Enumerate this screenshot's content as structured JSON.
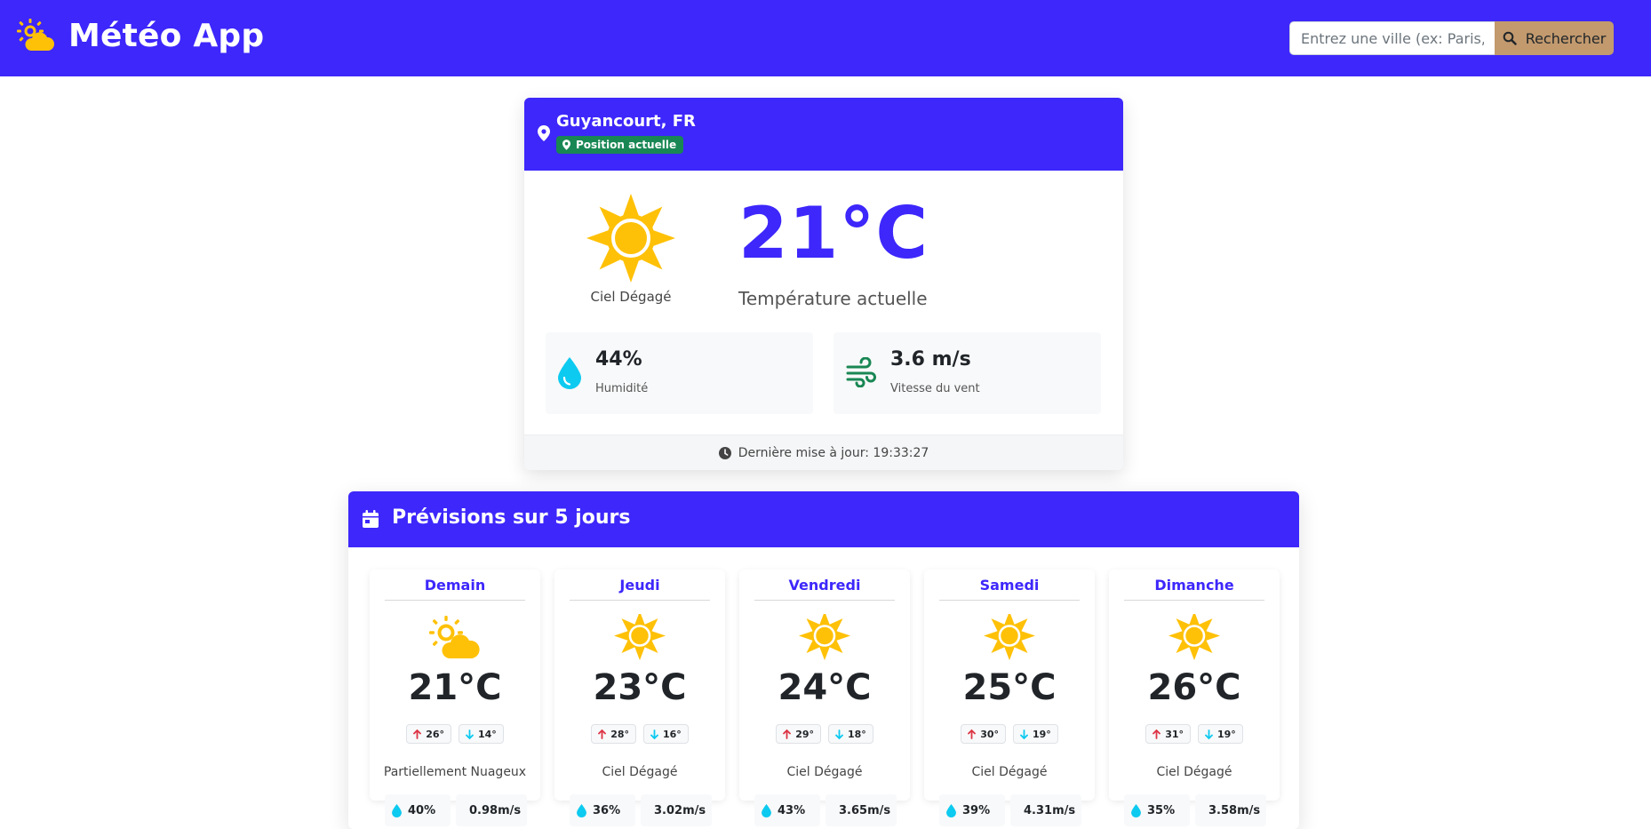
{
  "header": {
    "title": "Météo App",
    "search_placeholder": "Entrez une ville (ex: Paris, London...)",
    "search_value": "",
    "search_button": "Rechercher"
  },
  "current": {
    "city": "Guyancourt, FR",
    "badge": "Position actuelle",
    "condition": "Ciel Dégagé",
    "temperature": "21°C",
    "temperature_label": "Température actuelle",
    "humidity_value": "44%",
    "humidity_label": "Humidité",
    "wind_value": "3.6 m/s",
    "wind_label": "Vitesse du vent",
    "updated": "Dernière mise à jour: 19:33:27"
  },
  "forecast": {
    "title": "Prévisions sur 5 jours",
    "days": [
      {
        "name": "Demain",
        "icon": "partly-cloudy-icon",
        "temp": "21°C",
        "max": "26°",
        "min": "14°",
        "desc": "Partiellement Nuageux",
        "humidity": "40%",
        "wind": "0.98m/s"
      },
      {
        "name": "Jeudi",
        "icon": "sun-icon",
        "temp": "23°C",
        "max": "28°",
        "min": "16°",
        "desc": "Ciel Dégagé",
        "humidity": "36%",
        "wind": "3.02m/s"
      },
      {
        "name": "Vendredi",
        "icon": "sun-icon",
        "temp": "24°C",
        "max": "29°",
        "min": "18°",
        "desc": "Ciel Dégagé",
        "humidity": "43%",
        "wind": "3.65m/s"
      },
      {
        "name": "Samedi",
        "icon": "sun-icon",
        "temp": "25°C",
        "max": "30°",
        "min": "19°",
        "desc": "Ciel Dégagé",
        "humidity": "39%",
        "wind": "4.31m/s"
      },
      {
        "name": "Dimanche",
        "icon": "sun-icon",
        "temp": "26°C",
        "max": "31°",
        "min": "19°",
        "desc": "Ciel Dégagé",
        "humidity": "35%",
        "wind": "3.58m/s"
      }
    ]
  },
  "colors": {
    "primary": "#3d27fb",
    "sun": "#ffc107",
    "search_button": "#c29a6e",
    "badge": "#198754",
    "humidity_icon": "#0dcaf0",
    "wind_icon": "#198754",
    "arrow_up": "#dc3545",
    "arrow_down": "#0dcaf0"
  }
}
